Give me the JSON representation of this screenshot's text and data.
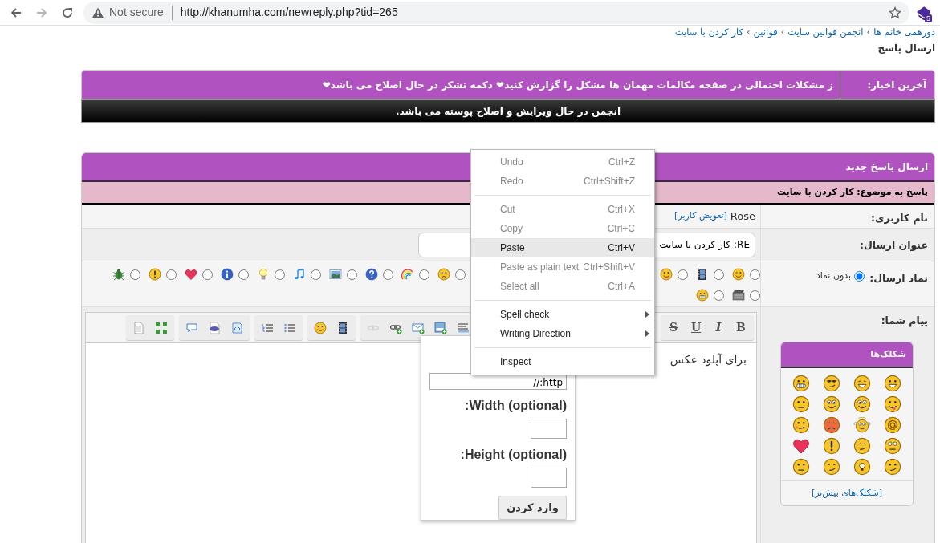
{
  "browser": {
    "security": "Not secure",
    "url": "http://khanumha.com/newreply.php?tid=265",
    "extension_badge": "5"
  },
  "breadcrumb": [
    {
      "label": "دورهمی خانم ها",
      "separator": "›"
    },
    {
      "label": "انجمن قوانین سایت",
      "separator": "›"
    },
    {
      "label": "قوانین",
      "separator": "›"
    },
    {
      "label": "کار کردن با سایت"
    }
  ],
  "page_title": "ارسال پاسخ",
  "news": {
    "label": "آخرین اخبار:",
    "text": "ز مشکلات احتمالی در صفحه مکالمات مهمان ها مشکل را گزارش کنید❤ دکمه تشکر در حال اصلاح می باشد❤"
  },
  "notice": "انجمن در حال ویرایش و اصلاح پوسته می باشد.",
  "form": {
    "title": "ارسال پاسخ جدید",
    "subtitle": "پاسخ به موضوع: کار کردن با سایت",
    "username": {
      "label": "نام کاربری:",
      "value": "Rose",
      "link": "[تعویض کاربر]"
    },
    "subject": {
      "label": "عنوان ارسال:",
      "value": "RE: کار کردن با سایت"
    },
    "post_icon": {
      "label": "نماد ارسال:",
      "none_option": {
        "label": "بدون نماد",
        "selected": true
      },
      "row_1_right": [
        {
          "kind": "wink",
          "selected": false
        },
        {
          "kind": "film",
          "selected": false
        },
        {
          "kind": "tongue",
          "selected": false
        }
      ],
      "row_1_left": [
        {
          "kind": "sad",
          "selected": false
        },
        {
          "kind": "rainbow",
          "selected": false
        },
        {
          "kind": "question",
          "selected": false
        },
        {
          "kind": "picture",
          "selected": false
        },
        {
          "kind": "music",
          "selected": false
        },
        {
          "kind": "bulb",
          "selected": false
        },
        {
          "kind": "info",
          "selected": false
        },
        {
          "kind": "heart",
          "selected": false
        },
        {
          "kind": "exclamation",
          "selected": false
        },
        {
          "kind": "bug",
          "selected": false
        }
      ],
      "row_2": [
        {
          "kind": "clapper",
          "selected": false
        },
        {
          "kind": "grin",
          "selected": false
        }
      ]
    },
    "message": {
      "label": "پیام شما:",
      "text": "برای آپلود عکس",
      "toolbar_right": [
        {
          "buttons": [
            {
              "kind": "bold",
              "label": "B",
              "disabled": false
            },
            {
              "kind": "italic",
              "label": "I",
              "disabled": false
            },
            {
              "kind": "underline",
              "label": "U",
              "disabled": false
            },
            {
              "kind": "strike",
              "label": "S",
              "disabled": false
            }
          ]
        }
      ],
      "toolbar_left": [
        {
          "buttons": [
            {
              "kind": "align",
              "disabled": false
            },
            {
              "kind": "image",
              "disabled": false
            },
            {
              "kind": "email",
              "disabled": false
            },
            {
              "kind": "link",
              "disabled": false
            },
            {
              "kind": "unlink",
              "disabled": true
            }
          ]
        },
        {
          "buttons": [
            {
              "kind": "video",
              "disabled": false
            },
            {
              "kind": "smiley",
              "disabled": false
            }
          ]
        },
        {
          "buttons": [
            {
              "kind": "bullets",
              "disabled": false
            },
            {
              "kind": "numbers",
              "disabled": false
            }
          ]
        },
        {
          "buttons": [
            {
              "kind": "code",
              "disabled": false
            },
            {
              "kind": "php",
              "disabled": false
            },
            {
              "kind": "quote",
              "disabled": false
            }
          ]
        },
        {
          "buttons": [
            {
              "kind": "fullscreen",
              "disabled": false
            },
            {
              "kind": "document",
              "disabled": false
            }
          ]
        }
      ]
    },
    "smilies": {
      "title": "شکلک‌ها",
      "more_link": "[شکلک‌های بیش‌تر]",
      "items": [
        {
          "kind": "smile"
        },
        {
          "kind": "happy"
        },
        {
          "kind": "cool"
        },
        {
          "kind": "teeth"
        },
        {
          "kind": "tongue"
        },
        {
          "kind": "eyes"
        },
        {
          "kind": "eyes"
        },
        {
          "kind": "frown"
        },
        {
          "kind": "at"
        },
        {
          "kind": "angel"
        },
        {
          "kind": "angry"
        },
        {
          "kind": "blush"
        },
        {
          "kind": "dizzy"
        },
        {
          "kind": "squint"
        },
        {
          "kind": "exclamation"
        },
        {
          "kind": "heart"
        },
        {
          "kind": "huh"
        },
        {
          "kind": "idea"
        },
        {
          "kind": "sleepy"
        },
        {
          "kind": "frown"
        }
      ]
    }
  },
  "image_popup": {
    "url_value": "http://",
    "width_label": ":Width (optional)",
    "height_label": ":Height (optional)",
    "button": "وارد کردن"
  },
  "context_menu": [
    {
      "kind": "item",
      "label": "Undo",
      "shortcut": "Ctrl+Z",
      "disabled": true,
      "highlighted": false
    },
    {
      "kind": "item",
      "label": "Redo",
      "shortcut": "Ctrl+Shift+Z",
      "disabled": true,
      "highlighted": false
    },
    {
      "kind": "separator"
    },
    {
      "kind": "item",
      "label": "Cut",
      "shortcut": "Ctrl+X",
      "disabled": true,
      "highlighted": false
    },
    {
      "kind": "item",
      "label": "Copy",
      "shortcut": "Ctrl+C",
      "disabled": true,
      "highlighted": false
    },
    {
      "kind": "item",
      "label": "Paste",
      "shortcut": "Ctrl+V",
      "disabled": false,
      "highlighted": true
    },
    {
      "kind": "item",
      "label": "Paste as plain text",
      "shortcut": "Ctrl+Shift+V",
      "disabled": true,
      "highlighted": false
    },
    {
      "kind": "item",
      "label": "Select all",
      "shortcut": "Ctrl+A",
      "disabled": true,
      "highlighted": false
    },
    {
      "kind": "separator"
    },
    {
      "kind": "submenu",
      "label": "Spell check",
      "disabled": false,
      "highlighted": false
    },
    {
      "kind": "submenu",
      "label": "Writing Direction",
      "disabled": false,
      "highlighted": false
    },
    {
      "kind": "separator"
    },
    {
      "kind": "item",
      "label": "Inspect",
      "disabled": false,
      "highlighted": false
    }
  ]
}
